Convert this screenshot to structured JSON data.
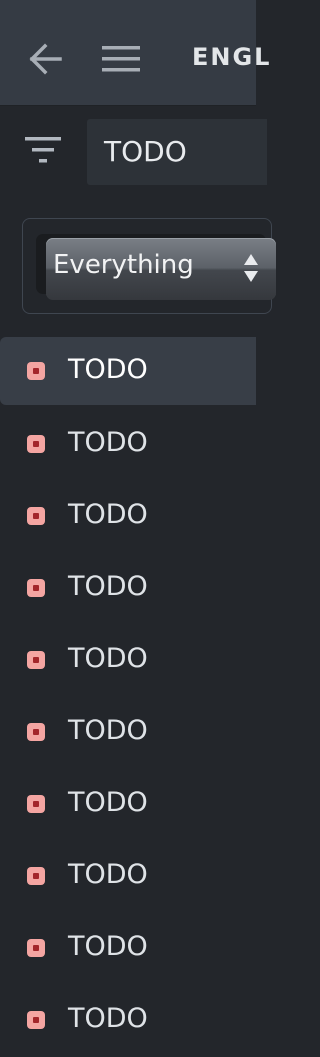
{
  "header": {
    "title": "ENGL",
    "back_icon": "arrow-left-icon",
    "menu_icon": "hamburger-menu-icon"
  },
  "filter": {
    "icon": "filter-icon",
    "value": "TODO"
  },
  "select": {
    "selected": "Everything"
  },
  "list": {
    "items": [
      {
        "label": "TODO"
      },
      {
        "label": "TODO"
      },
      {
        "label": "TODO"
      },
      {
        "label": "TODO"
      },
      {
        "label": "TODO"
      },
      {
        "label": "TODO"
      },
      {
        "label": "TODO"
      },
      {
        "label": "TODO"
      },
      {
        "label": "TODO"
      },
      {
        "label": "TODO"
      }
    ]
  },
  "colors": {
    "background": "#23262b",
    "topbar": "#353b44",
    "selected_row": "#383e47",
    "badge": "#f4a5a2",
    "badge_center": "#a3262b"
  }
}
